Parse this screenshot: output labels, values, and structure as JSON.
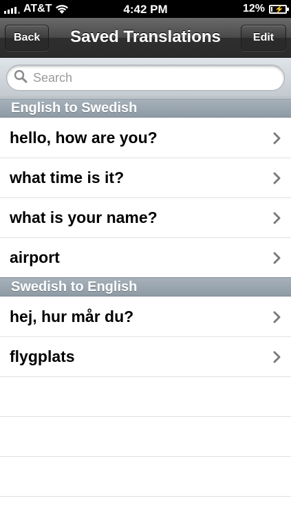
{
  "status_bar": {
    "carrier": "AT&T",
    "time": "4:42 PM",
    "battery_percent": "12%",
    "battery_level": 0.12,
    "icons": [
      "signal-icon",
      "wifi-icon",
      "battery-charging-icon"
    ]
  },
  "nav": {
    "back_label": "Back",
    "title": "Saved Translations",
    "edit_label": "Edit"
  },
  "search": {
    "placeholder": "Search",
    "value": ""
  },
  "sections": [
    {
      "header": "English to Swedish",
      "items": [
        "hello, how are you?",
        "what time is it?",
        "what is your name?",
        "airport"
      ]
    },
    {
      "header": "Swedish to English",
      "items": [
        "hej, hur mår du?",
        "flygplats"
      ]
    }
  ],
  "colors": {
    "nav_bar": "#3c3c3c",
    "section_header": "#98a4ae",
    "chevron": "#7a7a7a"
  }
}
